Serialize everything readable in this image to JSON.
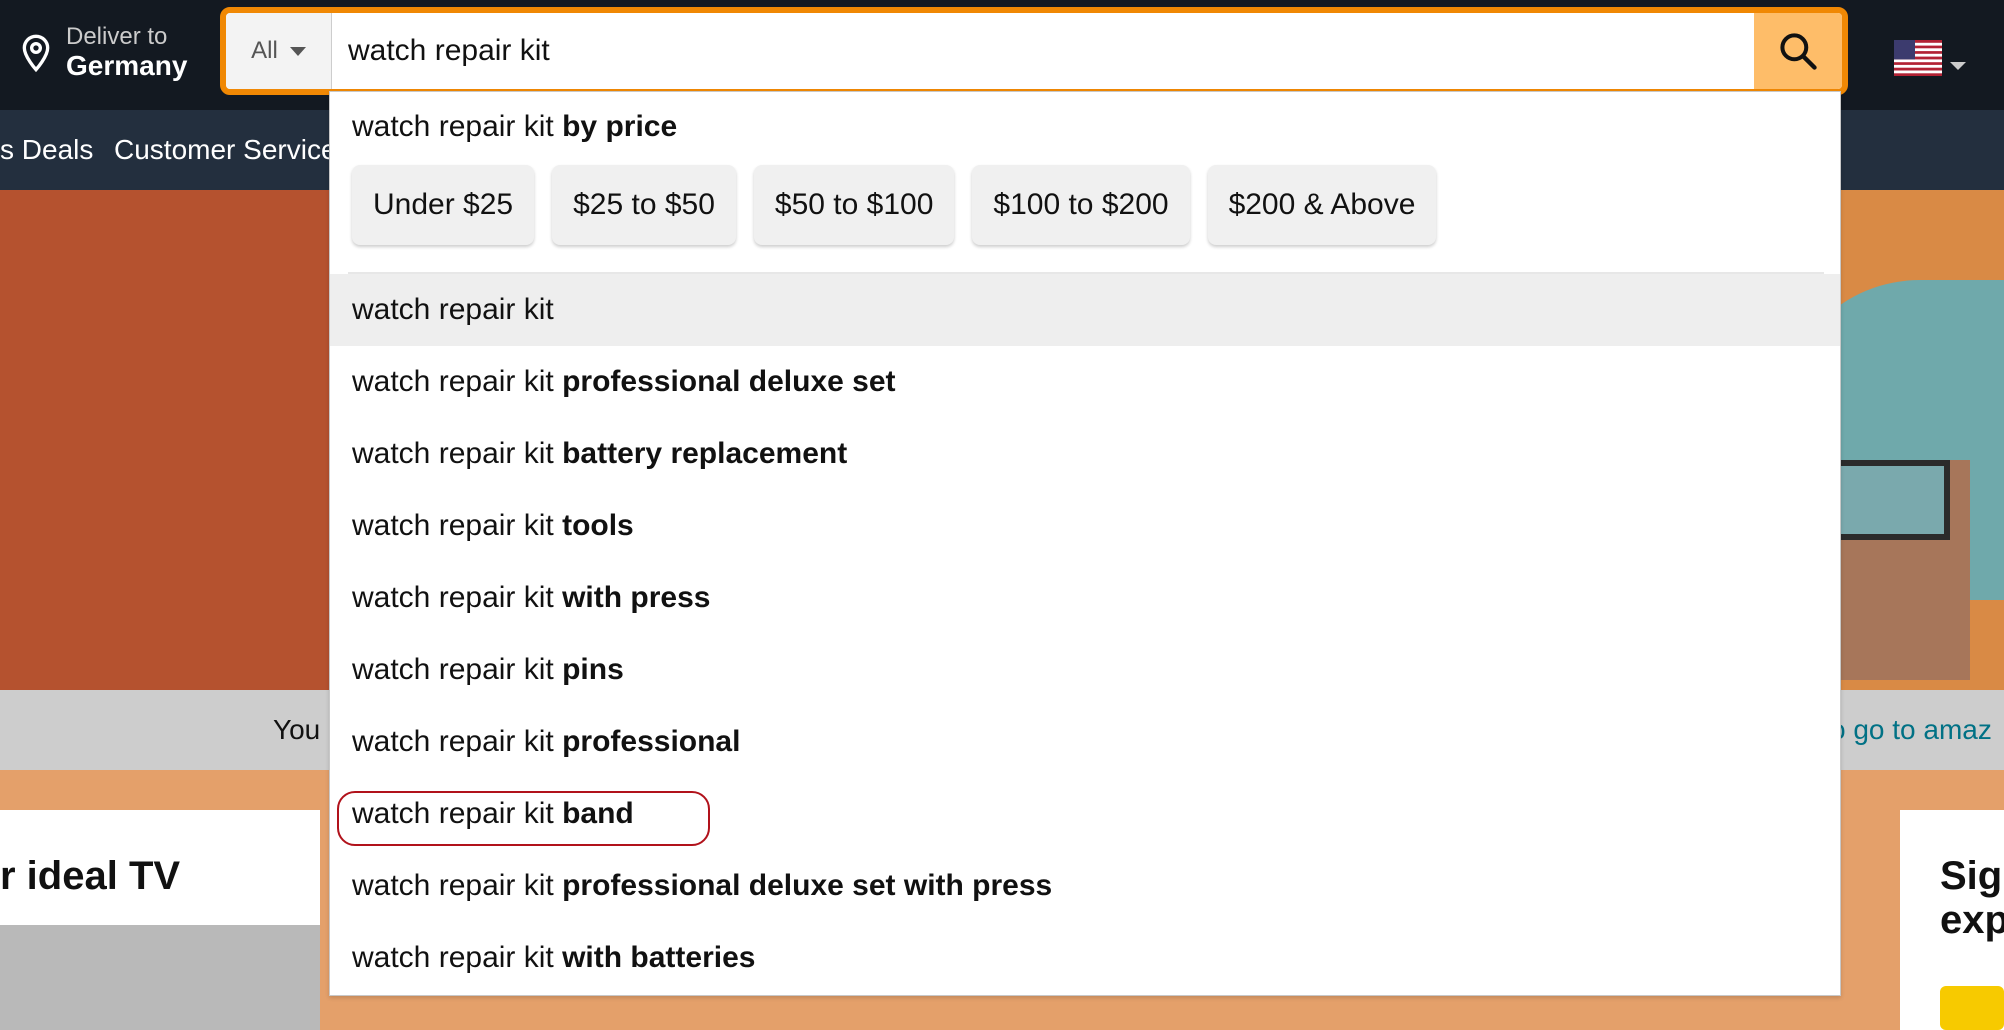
{
  "header": {
    "deliver_label": "Deliver to",
    "deliver_location": "Germany",
    "search": {
      "category": "All",
      "query": "watch repair kit"
    }
  },
  "nav": {
    "items": [
      "s Deals",
      "Customer Service"
    ]
  },
  "page": {
    "notice_left": "You",
    "notice_right": "o go to amaz",
    "card_left_title": "r ideal TV",
    "card_right_title_line1": "Sig",
    "card_right_title_line2": "exp"
  },
  "dropdown": {
    "heading_prefix": "watch repair kit",
    "heading_bold": "by price",
    "price_chips": [
      "Under $25",
      "$25 to $50",
      "$50 to $100",
      "$100 to $200",
      "$200 & Above"
    ],
    "suggestions": [
      {
        "prefix": "watch repair kit",
        "bold": ""
      },
      {
        "prefix": "watch repair kit ",
        "bold": "professional deluxe set"
      },
      {
        "prefix": "watch repair kit ",
        "bold": "battery replacement"
      },
      {
        "prefix": "watch repair kit ",
        "bold": "tools"
      },
      {
        "prefix": "watch repair kit ",
        "bold": "with press"
      },
      {
        "prefix": "watch repair kit ",
        "bold": "pins"
      },
      {
        "prefix": "watch repair kit ",
        "bold": "professional"
      },
      {
        "prefix": "watch repair kit ",
        "bold": "band"
      },
      {
        "prefix": "watch repair kit ",
        "bold": "professional deluxe set with press"
      },
      {
        "prefix": "watch repair kit ",
        "bold": "with batteries"
      }
    ]
  },
  "colors": {
    "header_bg": "#131921",
    "nav_bg": "#232f3e",
    "search_focus": "#f08804",
    "search_button": "#febd69",
    "highlight_ring": "#b1121b"
  }
}
